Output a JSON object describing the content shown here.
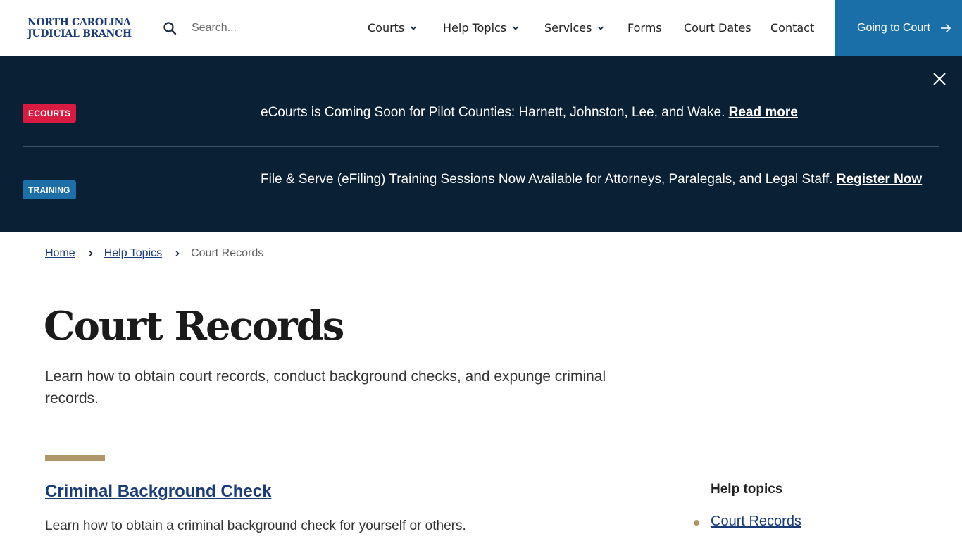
{
  "header": {
    "logo_line1": "NORTH CAROLINA",
    "logo_line2": "JUDICIAL BRANCH",
    "search_placeholder": "Search...",
    "search_icon": "search-icon",
    "nav": [
      {
        "label": "Courts",
        "has_dropdown": true
      },
      {
        "label": "Help Topics",
        "has_dropdown": true
      },
      {
        "label": "Services",
        "has_dropdown": true
      },
      {
        "label": "Forms",
        "has_dropdown": false
      },
      {
        "label": "Court Dates",
        "has_dropdown": false
      },
      {
        "label": "Contact",
        "has_dropdown": false
      }
    ],
    "cta_label": "Going to Court",
    "cta_icon": "arrow-right-icon",
    "cta_color": "#1a6fa8"
  },
  "alerts": {
    "background": "#0a2035",
    "close_icon": "close-icon",
    "items": [
      {
        "badge": "ECOURTS",
        "badge_color": "#d91a41",
        "text": "eCourts is Coming Soon for Pilot Counties: Harnett, Johnston, Lee, and Wake.",
        "link": "Read more"
      },
      {
        "badge": "TRAINING",
        "badge_color": "#1c6fa7",
        "text": "File & Serve (eFiling) Training Sessions Now Available for Attorneys, Paralegals, and Legal Staff.",
        "link": "Register Now"
      }
    ]
  },
  "breadcrumb": {
    "items": [
      {
        "label": "Home",
        "link": true
      },
      {
        "label": "Help Topics",
        "link": true
      },
      {
        "label": "Court Records",
        "link": false
      }
    ]
  },
  "page": {
    "title": "Court Records",
    "description": "Learn how to obtain court records, conduct background checks, and expunge criminal records.",
    "accent_color": "#b09668"
  },
  "sections": [
    {
      "title": "Criminal Background Check",
      "description": "Learn how to obtain a criminal background check for yourself or others."
    }
  ],
  "sidebar": {
    "heading": "Help topics",
    "items": [
      {
        "label": "Court Records",
        "active": true
      }
    ]
  }
}
